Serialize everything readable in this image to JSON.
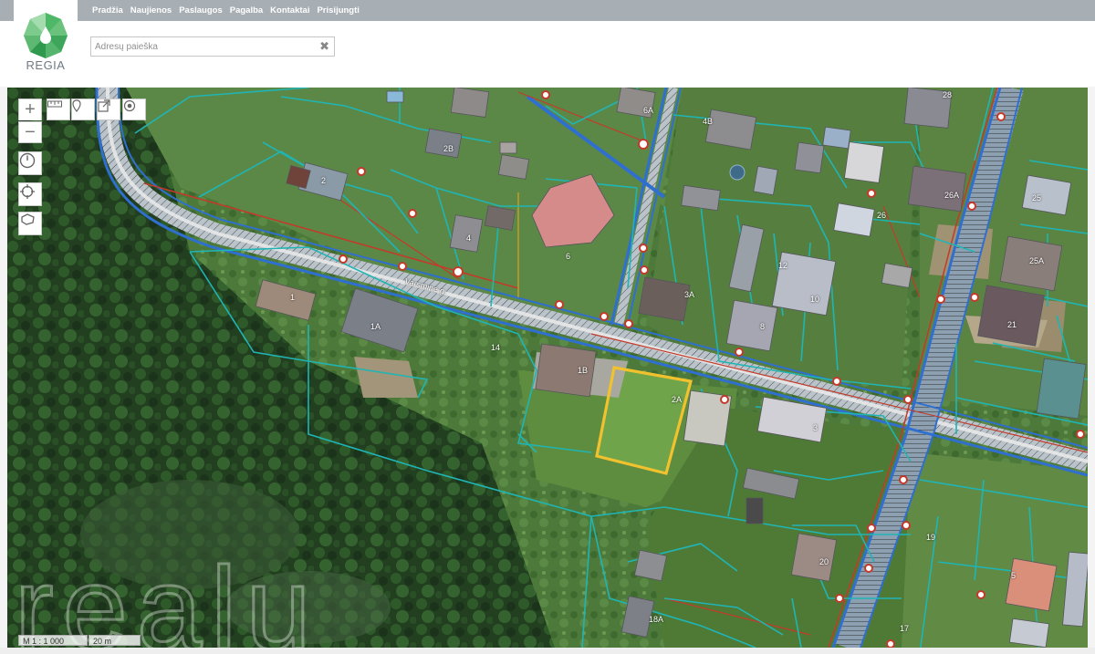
{
  "header": {
    "nav": [
      "Pradžia",
      "Naujienos",
      "Paslaugos",
      "Pagalba",
      "Kontaktai",
      "Prisijungti"
    ],
    "logo_text": "REGIA",
    "search_placeholder": "Adresų paieška"
  },
  "map": {
    "scale_ratio": "M 1 : 1 000",
    "scale_bar": "20 m",
    "watermark": "realu",
    "street_label": "Varsmine g.",
    "house_numbers": [
      "2",
      "2B",
      "4",
      "6",
      "1",
      "1A",
      "14",
      "1B",
      "2A",
      "3A",
      "8",
      "10",
      "12",
      "3",
      "26",
      "26A",
      "25",
      "21",
      "25A",
      "28",
      "20",
      "19",
      "17",
      "5",
      "6A",
      "4B",
      "18A"
    ]
  },
  "colors": {
    "parcel": "#1fb5b5",
    "road_blue": "#2f6fd0",
    "red_line": "#c43a2a",
    "selected": "#f2c12e"
  }
}
